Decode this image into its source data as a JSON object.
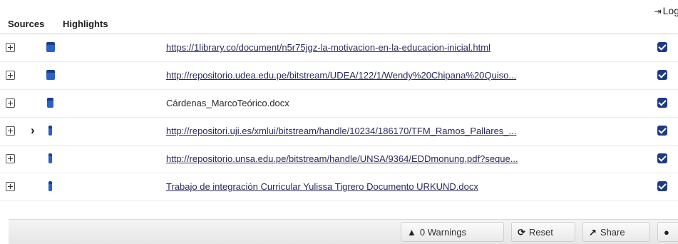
{
  "header": {
    "tabs": [
      {
        "label": "Sources"
      },
      {
        "label": "Highlights"
      }
    ],
    "login_label": "Log"
  },
  "sources": [
    {
      "label": "https://1library.co/document/n5r75jgz-la-motivacion-en-la-educacion-inicial.html",
      "is_link": true,
      "icon": "document-icon",
      "checked": true
    },
    {
      "label": "http://repositorio.udea.edu.pe/bitstream/UDEA/122/1/Wendy%20Chipana%20Quiso...",
      "is_link": true,
      "icon": "document-icon",
      "checked": true
    },
    {
      "label": "Cárdenas_MarcoTeórico.docx",
      "is_link": false,
      "icon": "document-icon",
      "checked": true
    },
    {
      "label": "http://repositori.uji.es/xmlui/bitstream/handle/10234/186170/TFM_Ramos_Pallares_...",
      "is_link": true,
      "icon": "document-icon",
      "checked": true,
      "current": true
    },
    {
      "label": "http://repositorio.unsa.edu.pe/bitstream/handle/UNSA/9364/EDDmonung.pdf?seque...",
      "is_link": true,
      "icon": "document-icon",
      "checked": true
    },
    {
      "label": "Trabajo de integración Curricular Yulissa Tigrero Documento URKUND.docx",
      "is_link": true,
      "icon": "document-icon",
      "checked": true
    }
  ],
  "footer": {
    "warnings_label": "0 Warnings",
    "reset_label": "Reset",
    "share_label": "Share"
  }
}
